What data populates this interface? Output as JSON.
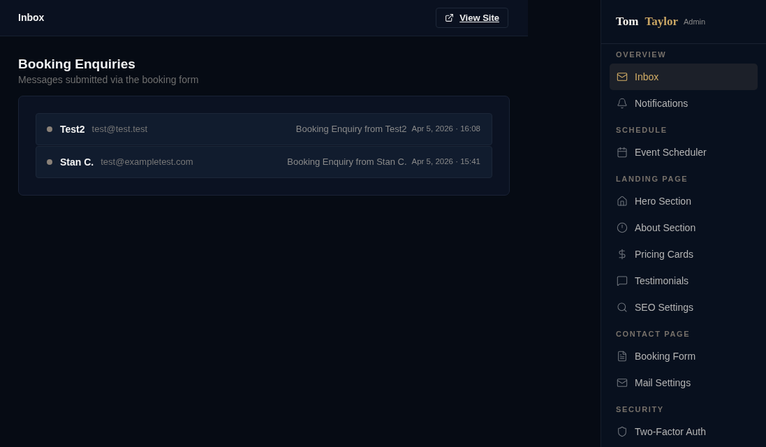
{
  "header": {
    "title": "Inbox",
    "view_site_button": "View Site"
  },
  "page": {
    "title": "Booking Enquiries",
    "subtitle": "Messages submitted via the booking form"
  },
  "messages": [
    {
      "name": "Test2",
      "email": "test@test.test",
      "subject": "Booking Enquiry from Test2",
      "date": "Apr 5, 2026 · 16:08"
    },
    {
      "name": "Stan C.",
      "email": "test@exampletest.com",
      "subject": "Booking Enquiry from Stan C.",
      "date": "Apr 5, 2026 · 15:41"
    }
  ],
  "sidebar": {
    "brand": {
      "first": "Tom",
      "last": "Taylor",
      "badge": "Admin"
    },
    "sections": [
      {
        "label": "OVERVIEW",
        "items": [
          {
            "label": "Inbox",
            "selected": true
          },
          {
            "label": "Notifications",
            "selected": false
          }
        ]
      },
      {
        "label": "SCHEDULE",
        "items": [
          {
            "label": "Event Scheduler",
            "selected": false
          }
        ]
      },
      {
        "label": "LANDING PAGE",
        "items": [
          {
            "label": "Hero Section",
            "selected": false
          },
          {
            "label": "About Section",
            "selected": false
          },
          {
            "label": "Pricing Cards",
            "selected": false
          },
          {
            "label": "Testimonials",
            "selected": false
          },
          {
            "label": "SEO Settings",
            "selected": false
          }
        ]
      },
      {
        "label": "CONTACT PAGE",
        "items": [
          {
            "label": "Booking Form",
            "selected": false
          },
          {
            "label": "Mail Settings",
            "selected": false
          }
        ]
      },
      {
        "label": "SECURITY",
        "items": [
          {
            "label": "Two-Factor Auth",
            "selected": false
          }
        ]
      }
    ]
  }
}
